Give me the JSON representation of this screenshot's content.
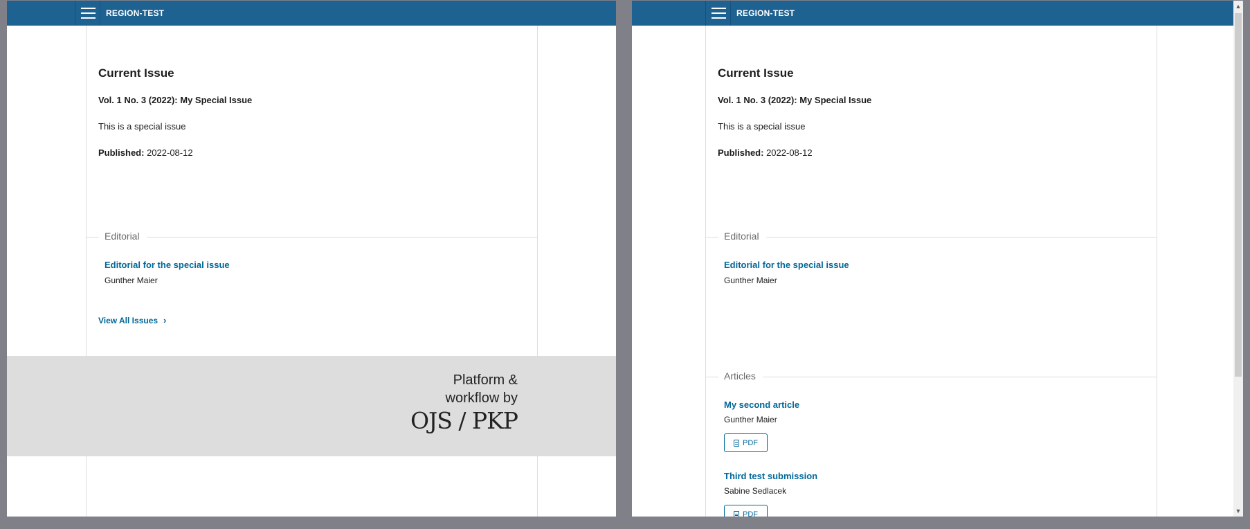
{
  "header": {
    "site_name": "REGION-TEST"
  },
  "issue": {
    "heading": "Current Issue",
    "title": "Vol. 1 No. 3 (2022): My Special Issue",
    "description": "This is a special issue",
    "published_label": "Published:",
    "published_date": "2022-08-12"
  },
  "sections": {
    "editorial": {
      "label": "Editorial",
      "articles": [
        {
          "title": "Editorial for the special issue",
          "author": "Gunther Maier"
        }
      ]
    },
    "articles": {
      "label": "Articles",
      "articles": [
        {
          "title": "My second article",
          "author": "Gunther Maier",
          "galley": "PDF"
        },
        {
          "title": "Third test submission",
          "author": "Sabine Sedlacek",
          "galley": "PDF"
        }
      ]
    }
  },
  "view_all": "View All Issues",
  "footer": {
    "line1": "Platform &",
    "line2": "workflow by",
    "logo": "OJS / PKP"
  },
  "icons": {
    "menu": "hamburger-menu-icon",
    "chevron": "chevron-right-icon",
    "pdf": "file-pdf-icon"
  },
  "colors": {
    "navbar": "#1e6292",
    "link": "#006798",
    "footer_bg": "#dddddd"
  }
}
